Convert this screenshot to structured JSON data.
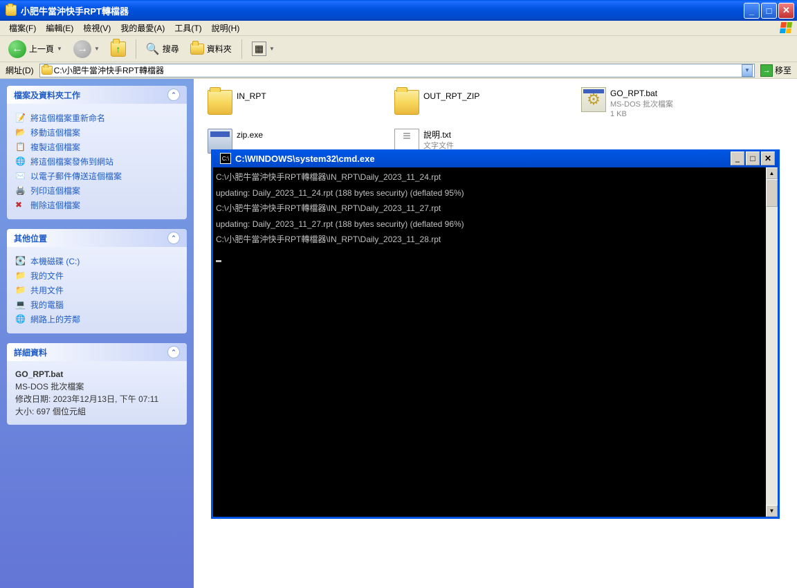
{
  "window": {
    "title": "小肥牛當沖快手RPT轉檔器"
  },
  "menu": {
    "file": "檔案(F)",
    "edit": "編輯(E)",
    "view": "檢視(V)",
    "favorites": "我的最愛(A)",
    "tools": "工具(T)",
    "help": "說明(H)"
  },
  "toolbar": {
    "back": "上一頁",
    "search": "搜尋",
    "folders": "資料夾"
  },
  "address": {
    "label": "網址(D)",
    "path": "C:\\小肥牛當沖快手RPT轉檔器",
    "go": "移至"
  },
  "sidebar": {
    "tasks": {
      "header": "檔案及資料夾工作",
      "items": {
        "rename": "將這個檔案重新命名",
        "move": "移動這個檔案",
        "copy": "複製這個檔案",
        "publish": "將這個檔案發佈到網站",
        "email": "以電子郵件傳送這個檔案",
        "print": "列印這個檔案",
        "delete": "刪除這個檔案"
      }
    },
    "places": {
      "header": "其他位置",
      "items": {
        "drive": "本機磁碟 (C:)",
        "mydocs": "我的文件",
        "shared": "共用文件",
        "mycomputer": "我的電腦",
        "network": "網路上的芳鄰"
      }
    },
    "details": {
      "header": "詳細資料",
      "name": "GO_RPT.bat",
      "type": "MS-DOS 批次檔案",
      "modified_label": "修改日期: ",
      "modified": "2023年12月13日, 下午 07:11",
      "size_label": "大小: ",
      "size": "697 個位元組"
    }
  },
  "files": {
    "in_rpt": {
      "name": "IN_RPT"
    },
    "out_rpt": {
      "name": "OUT_RPT_ZIP"
    },
    "go_rpt": {
      "name": "GO_RPT.bat",
      "type": "MS-DOS 批次檔案",
      "size": "1 KB"
    },
    "zip": {
      "name": "zip.exe"
    },
    "readme": {
      "name": "說明.txt",
      "type": "文字文件"
    }
  },
  "cmd": {
    "title": "C:\\WINDOWS\\system32\\cmd.exe",
    "lines": [
      "C:\\小肥牛當沖快手RPT轉檔器\\IN_RPT\\Daily_2023_11_24.rpt",
      "updating: Daily_2023_11_24.rpt (188 bytes security) (deflated 95%)",
      "C:\\小肥牛當沖快手RPT轉檔器\\IN_RPT\\Daily_2023_11_27.rpt",
      "updating: Daily_2023_11_27.rpt (188 bytes security) (deflated 96%)",
      "C:\\小肥牛當沖快手RPT轉檔器\\IN_RPT\\Daily_2023_11_28.rpt"
    ]
  }
}
